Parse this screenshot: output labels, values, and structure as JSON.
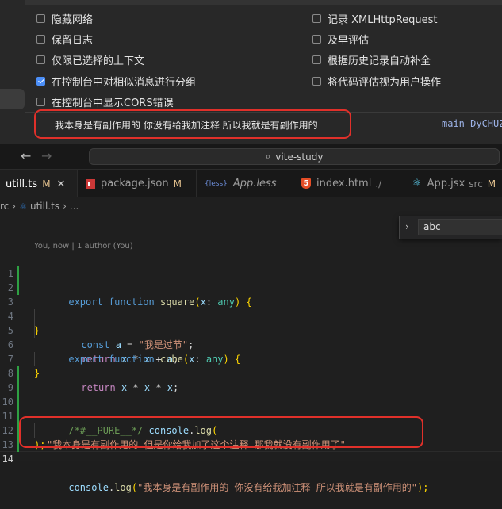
{
  "devtools": {
    "options_left": [
      {
        "label": "隐藏网络",
        "checked": false
      },
      {
        "label": "保留日志",
        "checked": false
      },
      {
        "label": "仅限已选择的上下文",
        "checked": false
      },
      {
        "label": "在控制台中对相似消息进行分组",
        "checked": true
      },
      {
        "label": "在控制台中显示CORS错误",
        "checked": false
      }
    ],
    "options_right": [
      {
        "label": "记录 XMLHttpRequest",
        "checked": false
      },
      {
        "label": "及早评估",
        "checked": false
      },
      {
        "label": "根据历史记录自动补全",
        "checked": false
      },
      {
        "label": "将代码评估视为用户操作",
        "checked": false
      }
    ],
    "console_message": "我本身是有副作用的 你没有给我加注释 所以我就是有副作用的",
    "console_source": "main-DyCHUZ"
  },
  "titlebar": {
    "search_text": "vite-study"
  },
  "tabs": [
    {
      "label": "utill.ts",
      "status": "M",
      "close": "✕",
      "active": true
    },
    {
      "label": "package.json",
      "status": "M",
      "active": false
    },
    {
      "label": "App.less",
      "active": false,
      "italic": true
    },
    {
      "label": "index.html",
      "sub": "./",
      "active": false
    },
    {
      "label": "App.jsx",
      "sub": "src",
      "status": "M",
      "active": false
    }
  ],
  "breadcrumb": {
    "folder": "rc",
    "file": "utill.ts",
    "rest": "..."
  },
  "find_widget": {
    "value": "abc"
  },
  "editor": {
    "blame": "You, now | 1 author (You)",
    "line_numbers": [
      "1",
      "2",
      "3",
      "4",
      "5",
      "6",
      "7",
      "8",
      "9",
      "10",
      "11",
      "12",
      "13",
      "14"
    ],
    "lines": {
      "l1": {
        "kw": "export",
        "kw2": "function",
        "fn": "square",
        "p1": "(",
        "param": "x",
        "colon": ": ",
        "type": "any",
        "p2": ")",
        "brace": " {"
      },
      "l2": {
        "kw": "const",
        "var": "a",
        "eq": " = ",
        "str": "\"我是过节\"",
        "semi": ";"
      },
      "l3": {
        "kw": "return",
        "expr_x1": "x",
        "op1": " * ",
        "expr_x2": "x",
        "op2": " + ",
        "expr_a": "a",
        "semi": ";"
      },
      "l4": {
        "brace": "}"
      },
      "l5": {
        "kw": "export",
        "kw2": "function",
        "fn": "cube",
        "p1": "(",
        "param": "x",
        "colon": ": ",
        "type": "any",
        "p2": ")",
        "brace": " {"
      },
      "l6": {
        "kw": "return",
        "expr_x1": "x",
        "op1": " * ",
        "expr_x2": "x",
        "op2": " * ",
        "expr_x3": "x",
        "semi": ";"
      },
      "l7": {
        "brace": "}"
      },
      "l9": {
        "comment": "/*#__PURE__*/",
        "obj": "console",
        "dot": ".",
        "fn": "log",
        "paren": "("
      },
      "l10": {
        "str": "\"我本身是有副作用的 但是你给我加了这个注释 那我就没有副作用了\""
      },
      "l11": {
        "close": ");"
      },
      "l13": {
        "obj": "console",
        "dot": ".",
        "fn": "log",
        "paren": "(",
        "str": "\"我本身是有副作用的 你没有给我加注释 所以我就是有副作用的\"",
        "close": ");"
      }
    }
  }
}
